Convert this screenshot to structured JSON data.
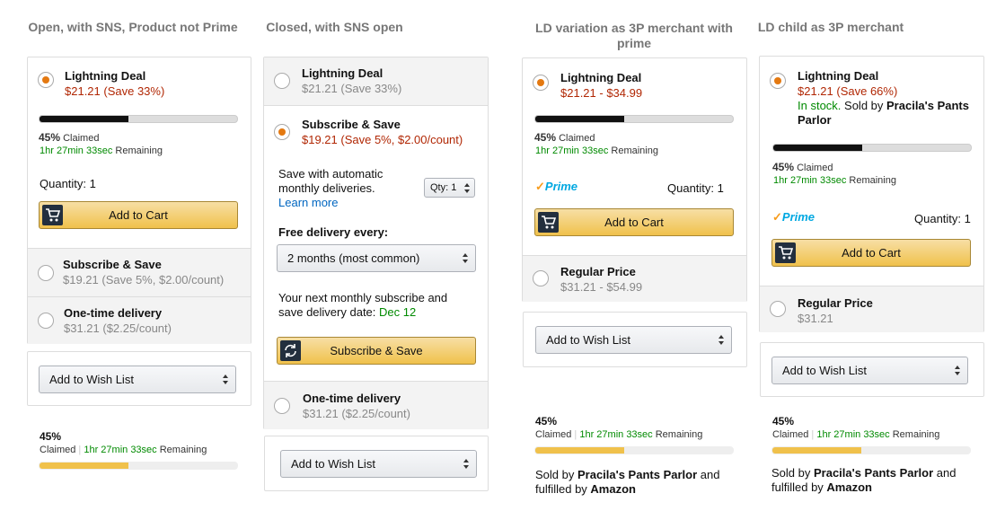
{
  "columns": [
    {
      "title": "Open, with SNS, Product not Prime",
      "deal": {
        "label": "Lightning Deal",
        "price": "$21.21 (Save 33%)",
        "claimed_pct_text": "45%",
        "claimed_word": "Claimed",
        "remaining_time": "1hr 27min 33sec",
        "remaining_word": "Remaining",
        "progress": 0.45
      },
      "quantity": "Quantity: 1",
      "add_to_cart": "Add to Cart",
      "sns": {
        "label": "Subscribe & Save",
        "price": "$19.21 (Save 5%, $2.00/count)"
      },
      "one_time": {
        "label": "One-time delivery",
        "price": "$31.21 ($2.25/count)"
      },
      "wishlist": "Add to Wish List",
      "summary": {
        "pct": "45%",
        "claimed_word": "Claimed",
        "time": "1hr 27min 33sec",
        "remaining_word": "Remaining",
        "progress": 0.45
      }
    },
    {
      "title": "Closed, with SNS open",
      "deal": {
        "label": "Lightning Deal",
        "price": "$21.21 (Save 33%)"
      },
      "sns": {
        "label": "Subscribe & Save",
        "price": "$19.21 (Save 5%, $2.00/count)",
        "desc_line1": "Save with automatic",
        "desc_line2": "monthly deliveries.",
        "learn_more": "Learn more",
        "qty": "Qty: 1",
        "freq_label": "Free delivery every:",
        "freq_value": "2 months (most common)",
        "next_line1": "Your next monthly subscribe and",
        "next_line2": "save delivery date: ",
        "next_date": "Dec 12",
        "button": "Subscribe & Save"
      },
      "one_time": {
        "label": "One-time delivery",
        "price": "$31.21 ($2.25/count)"
      },
      "wishlist": "Add to Wish List"
    },
    {
      "title": "LD variation as 3P merchant with prime",
      "deal": {
        "label": "Lightning Deal",
        "price": "$21.21 - $34.99",
        "claimed_pct_text": "45%",
        "claimed_word": "Claimed",
        "remaining_time": "1hr 27min 33sec",
        "remaining_word": "Remaining",
        "progress": 0.45
      },
      "prime": "Prime",
      "quantity": "Quantity: 1",
      "add_to_cart": "Add to Cart",
      "regular": {
        "label": "Regular Price",
        "price": "$31.21 - $54.99"
      },
      "wishlist": "Add to Wish List",
      "summary": {
        "pct": "45%",
        "claimed_word": "Claimed",
        "time": "1hr 27min 33sec",
        "remaining_word": "Remaining",
        "progress": 0.45
      },
      "sold_by": {
        "prefix": "Sold by ",
        "merchant": "Pracila's Pants Parlor",
        "mid": " and",
        "fulfilled": "fulfilled by ",
        "fulfiller": "Amazon"
      }
    },
    {
      "title": "LD child as 3P merchant",
      "deal": {
        "label": "Lightning Deal",
        "price": "$21.21 (Save 66%)",
        "stock": "In stock.",
        "sold_by_prefix": " Sold by ",
        "merchant_line1": "Pracila's Pants",
        "merchant_line2": "Parlor",
        "claimed_pct_text": "45%",
        "claimed_word": "Claimed",
        "remaining_time": "1hr 27min 33sec",
        "remaining_word": "Remaining",
        "progress": 0.45
      },
      "prime": "Prime",
      "quantity": "Quantity: 1",
      "add_to_cart": "Add to Cart",
      "regular": {
        "label": "Regular Price",
        "price": "$31.21"
      },
      "wishlist": "Add to Wish List",
      "summary": {
        "pct": "45%",
        "claimed_word": "Claimed",
        "time": "1hr 27min 33sec",
        "remaining_word": "Remaining",
        "progress": 0.45
      },
      "sold_by": {
        "prefix": "Sold by ",
        "merchant": "Pracila's Pants Parlor",
        "mid": " and",
        "fulfilled": "fulfilled by ",
        "fulfiller": "Amazon"
      }
    }
  ]
}
